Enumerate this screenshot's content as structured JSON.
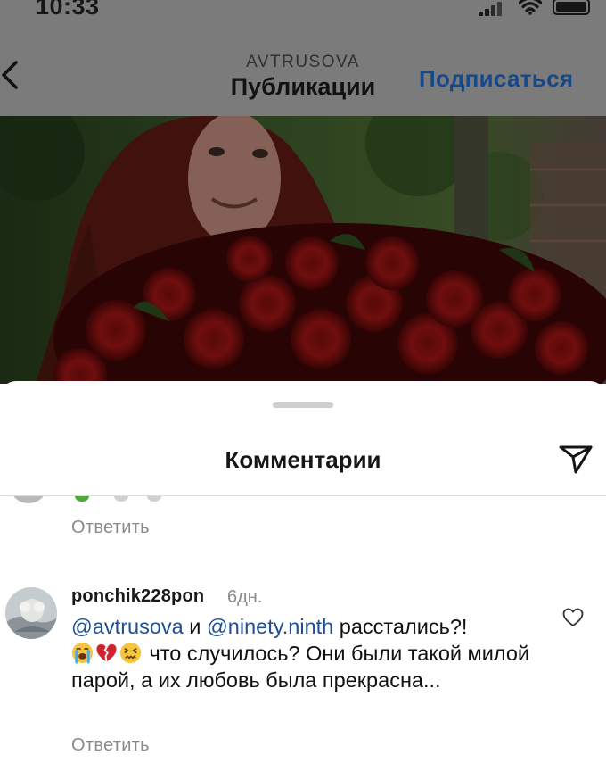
{
  "status_bar": {
    "time": "10:33"
  },
  "header": {
    "account": "AVTRUSOVA",
    "title": "Публикации",
    "subscribe_label": "Подписаться"
  },
  "sheet": {
    "title": "Комментарии"
  },
  "previous_comment": {
    "reply_label": "Ответить"
  },
  "comment": {
    "username": "ponchik228pon",
    "age": "6дн.",
    "mention_1": "@avtrusova",
    "conjunction": " и ",
    "mention_2": "@ninety.ninth",
    "text_1": " расстались?!",
    "text_2": " что случилось? Они были такой милой парой, а их любовь была прекрасна...",
    "emojis": [
      "loudly-crying-face",
      "broken-heart",
      "confounded-face"
    ],
    "reply_label": "Ответить"
  },
  "icons": {
    "back": "chevron-left-icon",
    "share": "send-icon",
    "like": "heart-outline-icon"
  },
  "colors": {
    "link": "#1d4f92",
    "subscribe": "#16488a",
    "muted": "#8a8a8a"
  }
}
